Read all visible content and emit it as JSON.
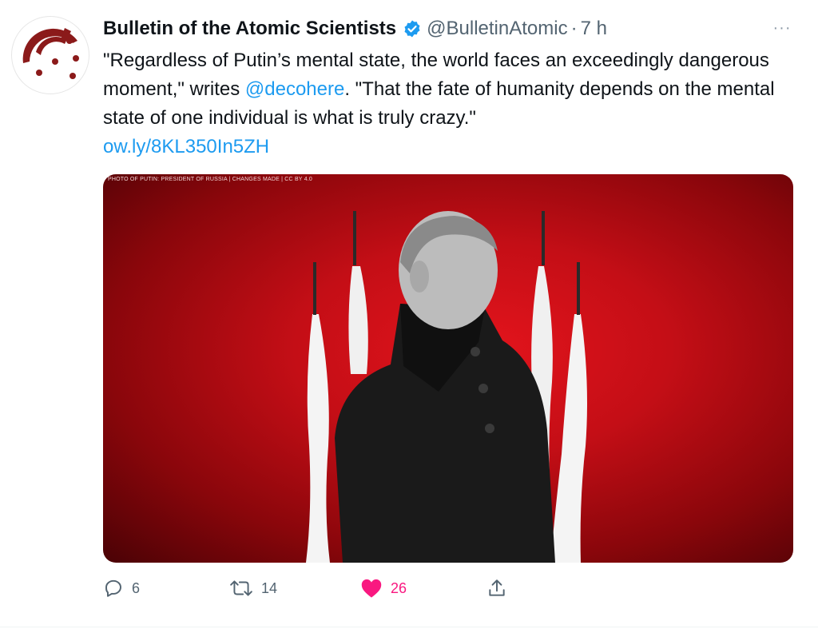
{
  "tweet": {
    "author_name": "Bulletin of the Atomic Scientists",
    "handle": "@BulletinAtomic",
    "separator": "·",
    "time": "7 h",
    "more_label": "···",
    "text_part1": "\"Regardless of Putin’s mental state, the world faces an exceedingly dangerous moment,\" writes ",
    "mention": "@decohere",
    "text_part2": ". \"That the fate of humanity depends on the mental state of one individual is what is truly crazy.\"",
    "link": "ow.ly/8KL350In5ZH",
    "image_credit": "PHOTO OF PUTIN: PRESIDENT OF RUSSIA | CHANGES MADE | CC BY 4.0"
  },
  "actions": {
    "reply_count": "6",
    "retweet_count": "14",
    "like_count": "26"
  },
  "colors": {
    "link": "#1d9bf0",
    "like": "#f91880",
    "verified": "#1d9bf0",
    "logo": "#8b1a1a"
  },
  "icons": [
    "doomsday-clock-logo",
    "verified-badge-icon",
    "more-icon",
    "reply-icon",
    "retweet-icon",
    "heart-icon",
    "share-icon"
  ]
}
